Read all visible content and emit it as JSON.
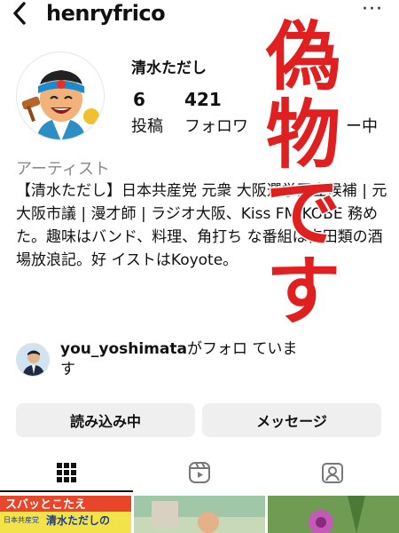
{
  "header": {
    "username": "henryfrico",
    "more_label": "···"
  },
  "profile": {
    "display_name": "清水ただし",
    "posts_count": "6",
    "posts_label": "投稿",
    "followers_count": "421",
    "followers_label": "フォロワ",
    "following_label": "ー中",
    "category": "アーティスト",
    "bio": "【清水ただし】日本共産党 元衆 大阪選挙区立候補 | 元大阪市議 | 漫才師 | ラジオ大阪、Kiss FM KOBE 務めた。趣味はバンド、料理、角打ち な番組は吉田類の酒場放浪記。好 イストはKoyote。"
  },
  "followed_by": {
    "username": "you_yoshimata",
    "suffix": "がフォロ  ていま",
    "line2": "す"
  },
  "actions": {
    "load_label": "読み込み中",
    "message_label": "メッセージ"
  },
  "tabs": [
    {
      "name": "grid-icon"
    },
    {
      "name": "reels-icon"
    },
    {
      "name": "tagged-icon"
    }
  ],
  "overlay": {
    "chars": [
      "偽",
      "物",
      "で",
      "す"
    ],
    "color": "#e02020"
  },
  "thumbnails": {
    "first_top": "スバッとこたえ",
    "first_party": "日本共産党",
    "first_name": "清水ただしの"
  }
}
